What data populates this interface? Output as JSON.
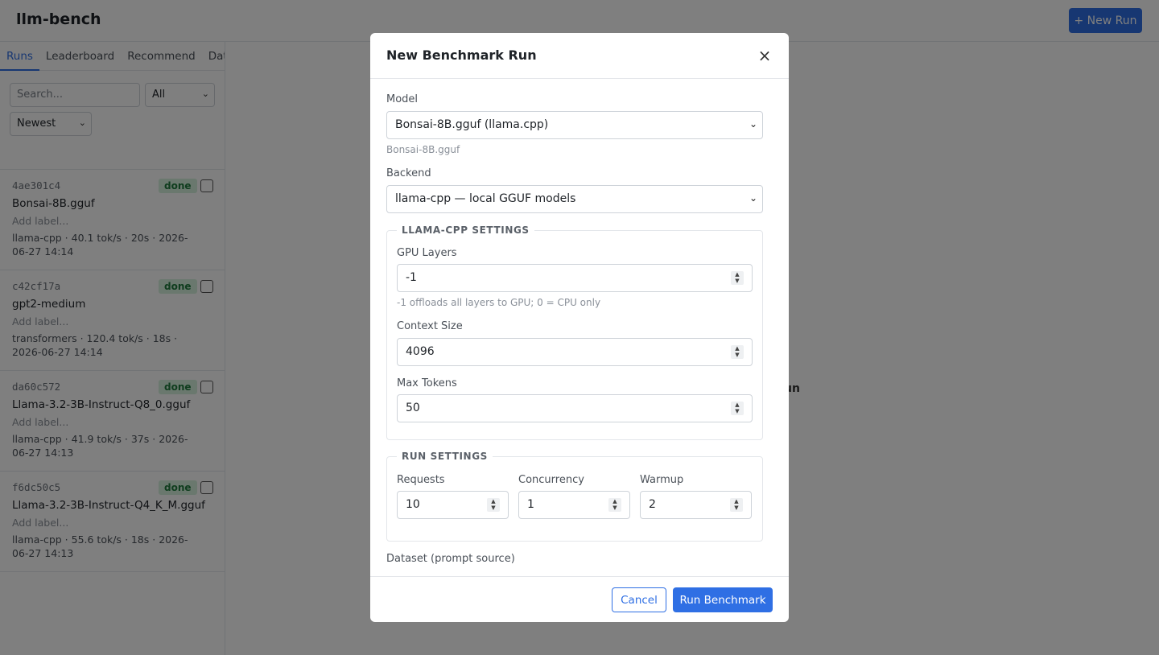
{
  "app": {
    "title": "llm-bench",
    "new_run_label": "+ New Run",
    "main_hint": "un"
  },
  "sidebar": {
    "tabs": [
      {
        "label": "Runs",
        "active": true
      },
      {
        "label": "Leaderboard",
        "active": false
      },
      {
        "label": "Recommend",
        "active": false
      },
      {
        "label": "Datase",
        "active": false
      }
    ],
    "search_placeholder": "Search...",
    "status_filter": "All",
    "sort": "Newest",
    "runs": [
      {
        "id": "4ae301c4",
        "status": "done",
        "model": "Bonsai-8B.gguf",
        "label_placeholder": "Add label...",
        "meta": "llama-cpp · 40.1 tok/s · 20s · 2026-06-27 14:14"
      },
      {
        "id": "c42cf17a",
        "status": "done",
        "model": "gpt2-medium",
        "label_placeholder": "Add label...",
        "meta": "transformers · 120.4 tok/s · 18s · 2026-06-27 14:14"
      },
      {
        "id": "da60c572",
        "status": "done",
        "model": "Llama-3.2-3B-Instruct-Q8_0.gguf",
        "label_placeholder": "Add label...",
        "meta": "llama-cpp · 41.9 tok/s · 37s · 2026-06-27 14:13"
      },
      {
        "id": "f6dc50c5",
        "status": "done",
        "model": "Llama-3.2-3B-Instruct-Q4_K_M.gguf",
        "label_placeholder": "Add label...",
        "meta": "llama-cpp · 55.6 tok/s · 18s · 2026-06-27 14:13"
      }
    ]
  },
  "modal": {
    "title": "New Benchmark Run",
    "close_icon": "×",
    "model_label": "Model",
    "model_value": "Bonsai-8B.gguf (llama.cpp)",
    "model_hint": "Bonsai-8B.gguf",
    "backend_label": "Backend",
    "backend_value": "llama-cpp — local GGUF models",
    "llama_section": {
      "legend": "LLAMA-CPP SETTINGS",
      "gpu_layers_label": "GPU Layers",
      "gpu_layers_value": "-1",
      "gpu_layers_hint": "-1 offloads all layers to GPU; 0 = CPU only",
      "context_label": "Context Size",
      "context_value": "4096",
      "max_tokens_label": "Max Tokens",
      "max_tokens_value": "50"
    },
    "run_section": {
      "legend": "RUN SETTINGS",
      "requests_label": "Requests",
      "requests_value": "10",
      "concurrency_label": "Concurrency",
      "concurrency_value": "1",
      "warmup_label": "Warmup",
      "warmup_value": "2"
    },
    "dataset_label": "Dataset (prompt source)",
    "cancel_label": "Cancel",
    "run_label": "Run Benchmark"
  }
}
